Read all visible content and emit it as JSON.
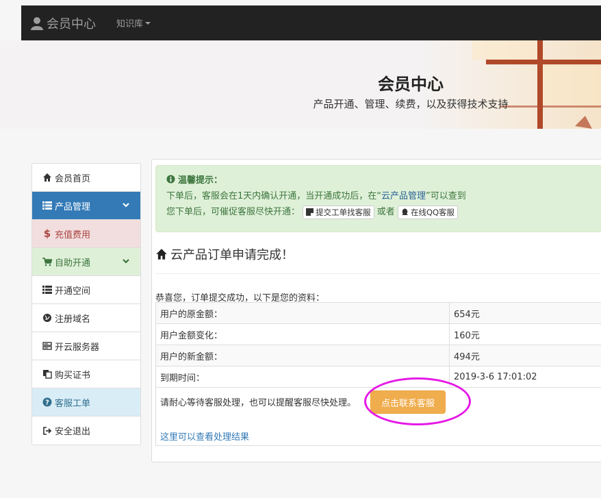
{
  "navbar": {
    "brand": "会员中心",
    "kb_label": "知识库"
  },
  "banner": {
    "title": "会员中心",
    "subtitle": "产品开通、管理、续费，以及获得技术支持"
  },
  "sidebar": {
    "items": [
      {
        "label": "会员首页",
        "icon": "home-icon"
      },
      {
        "label": "产品管理",
        "icon": "list-icon",
        "state": "active"
      },
      {
        "label": "充值费用",
        "icon": "dollar-icon",
        "state": "danger"
      },
      {
        "label": "自助开通",
        "icon": "cart-icon",
        "state": "success"
      },
      {
        "label": "开通空间",
        "icon": "list-icon"
      },
      {
        "label": "注册域名",
        "icon": "globe-icon"
      },
      {
        "label": "开云服务器",
        "icon": "server-icon"
      },
      {
        "label": "购买证书",
        "icon": "copy-icon"
      },
      {
        "label": "客服工单",
        "icon": "question-icon",
        "state": "info"
      },
      {
        "label": "安全退出",
        "icon": "logout-icon"
      }
    ]
  },
  "alert": {
    "title": "温馨提示：",
    "line1_pre": "下单后，客服会在1天内确认开通，当开通成功后，在“",
    "line1_link": "云产品管理",
    "line1_post": "”可以查到",
    "line2_pre": "您下单后，可催促客服尽快开通：",
    "ticket_button": "提交工单找客服",
    "or_text": "或者",
    "qq_button": "在线QQ客服"
  },
  "order": {
    "heading": "云产品订单申请完成！",
    "intro": "恭喜您，订单提交成功，以下是您的资料：",
    "rows": [
      {
        "key": "用户的原金额：",
        "value": "654元"
      },
      {
        "key": "用户金额变化：",
        "value": "160元"
      },
      {
        "key": "用户的新金额：",
        "value": "494元"
      },
      {
        "key": "到期时间：",
        "value": "2019-3-6 17:01:02"
      }
    ],
    "wait_text": "请耐心等待客服处理，也可以提醒客服尽快处理。",
    "contact_button": "点击联系客服",
    "result_link": "这里可以查看处理结果"
  },
  "colors": {
    "primary": "#337ab7",
    "warning": "#f0ad4e",
    "success_bg": "#dff0d8",
    "danger_bg": "#f2dede",
    "info_bg": "#d9edf7",
    "highlight_ring": "#e619e6"
  }
}
